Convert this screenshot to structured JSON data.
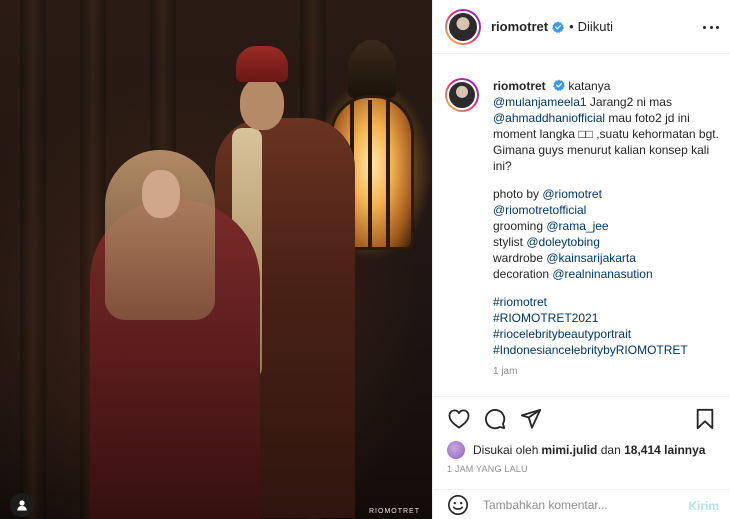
{
  "photo": {
    "watermark": "RIOMOTRET",
    "tag_user_icon": "user-icon"
  },
  "header": {
    "username": "riomotret",
    "separator": "•",
    "follow_state": "Diikuti",
    "verified_icon": "verified-badge-icon",
    "more_icon": "more-options-icon"
  },
  "caption": {
    "username": "riomotret",
    "lines": {
      "intro": "katanya",
      "mention1": "@mulanjameela1",
      "text1": " Jarang2 ni mas ",
      "mention2": "@ahmaddhaniofficial",
      "text2": " mau foto2 jd ini moment langka □□ ,suatu kehormatan bgt. Gimana guys menurut kalian konsep kali ini?"
    },
    "credits": [
      {
        "label": "photo by ",
        "mention": "@riomotret"
      },
      {
        "label": "",
        "mention": "@riomotretofficial"
      },
      {
        "label": "grooming ",
        "mention": "@rama_jee"
      },
      {
        "label": "stylist ",
        "mention": "@doleytobing"
      },
      {
        "label": "wardrobe ",
        "mention": "@kainsarijakarta"
      },
      {
        "label": "decoration ",
        "mention": "@realninanasution"
      }
    ],
    "hashtags": [
      "#riomotret",
      "#RIOMOTRET2021",
      "#riocelebritybeautyportrait",
      "#IndonesiancelebritybyRIOMOTRET"
    ],
    "time_ago": "1 jam"
  },
  "actions": {
    "like_icon": "heart-icon",
    "comment_icon": "comment-icon",
    "share_icon": "share-icon",
    "save_icon": "bookmark-icon",
    "likes_prefix": "Disukai oleh ",
    "likes_user": "mimi.julid",
    "likes_mid": " dan ",
    "likes_count": "18,414 lainnya",
    "posted": "1 JAM YANG LALU"
  },
  "comment": {
    "emoji_icon": "emoji-icon",
    "placeholder": "Tambahkan komentar...",
    "post_label": "Kirim"
  },
  "colors": {
    "link": "#00376b",
    "verified": "#3897f0",
    "muted": "#8e8e8e",
    "post_disabled": "#b2dffc"
  }
}
